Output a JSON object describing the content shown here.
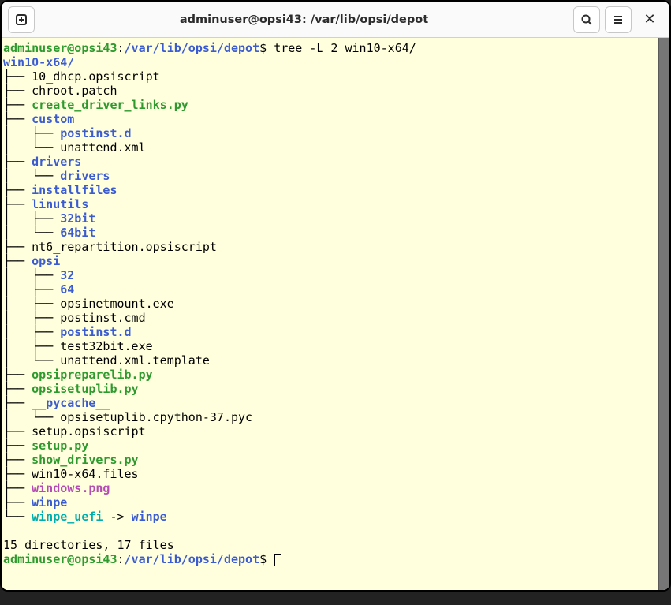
{
  "titlebar": {
    "title": "adminuser@opsi43: /var/lib/opsi/depot"
  },
  "prompt": {
    "user": "adminuser@opsi43",
    "path": "/var/lib/opsi/depot",
    "command": "tree -L 2 win10-x64/"
  },
  "tree": {
    "root": "win10-x64/",
    "lines": [
      {
        "prefix": "├── ",
        "name": "10_dhcp.opsiscript",
        "type": "file"
      },
      {
        "prefix": "├── ",
        "name": "chroot.patch",
        "type": "file"
      },
      {
        "prefix": "├── ",
        "name": "create_driver_links.py",
        "type": "exe"
      },
      {
        "prefix": "├── ",
        "name": "custom",
        "type": "dir"
      },
      {
        "prefix": "│   ├── ",
        "name": "postinst.d",
        "type": "dir"
      },
      {
        "prefix": "│   └── ",
        "name": "unattend.xml",
        "type": "file"
      },
      {
        "prefix": "├── ",
        "name": "drivers",
        "type": "dir"
      },
      {
        "prefix": "│   └── ",
        "name": "drivers",
        "type": "dir"
      },
      {
        "prefix": "├── ",
        "name": "installfiles",
        "type": "dir"
      },
      {
        "prefix": "├── ",
        "name": "linutils",
        "type": "dir"
      },
      {
        "prefix": "│   ├── ",
        "name": "32bit",
        "type": "dir"
      },
      {
        "prefix": "│   └── ",
        "name": "64bit",
        "type": "dir"
      },
      {
        "prefix": "├── ",
        "name": "nt6_repartition.opsiscript",
        "type": "file"
      },
      {
        "prefix": "├── ",
        "name": "opsi",
        "type": "dir"
      },
      {
        "prefix": "│   ├── ",
        "name": "32",
        "type": "dir"
      },
      {
        "prefix": "│   ├── ",
        "name": "64",
        "type": "dir"
      },
      {
        "prefix": "│   ├── ",
        "name": "opsinetmount.exe",
        "type": "file"
      },
      {
        "prefix": "│   ├── ",
        "name": "postinst.cmd",
        "type": "file"
      },
      {
        "prefix": "│   ├── ",
        "name": "postinst.d",
        "type": "dir"
      },
      {
        "prefix": "│   ├── ",
        "name": "test32bit.exe",
        "type": "file"
      },
      {
        "prefix": "│   └── ",
        "name": "unattend.xml.template",
        "type": "file"
      },
      {
        "prefix": "├── ",
        "name": "opsipreparelib.py",
        "type": "exe"
      },
      {
        "prefix": "├── ",
        "name": "opsisetuplib.py",
        "type": "exe"
      },
      {
        "prefix": "├── ",
        "name": "__pycache__",
        "type": "dir"
      },
      {
        "prefix": "│   └── ",
        "name": "opsisetuplib.cpython-37.pyc",
        "type": "file"
      },
      {
        "prefix": "├── ",
        "name": "setup.opsiscript",
        "type": "file"
      },
      {
        "prefix": "├── ",
        "name": "setup.py",
        "type": "exe"
      },
      {
        "prefix": "├── ",
        "name": "show_drivers.py",
        "type": "exe"
      },
      {
        "prefix": "├── ",
        "name": "win10-x64.files",
        "type": "file"
      },
      {
        "prefix": "├── ",
        "name": "windows.png",
        "type": "img"
      },
      {
        "prefix": "├── ",
        "name": "winpe",
        "type": "dir"
      },
      {
        "prefix": "└── ",
        "name": "winpe_uefi",
        "type": "link",
        "arrow": " -> ",
        "target": "winpe"
      }
    ]
  },
  "summary": "15 directories, 17 files"
}
